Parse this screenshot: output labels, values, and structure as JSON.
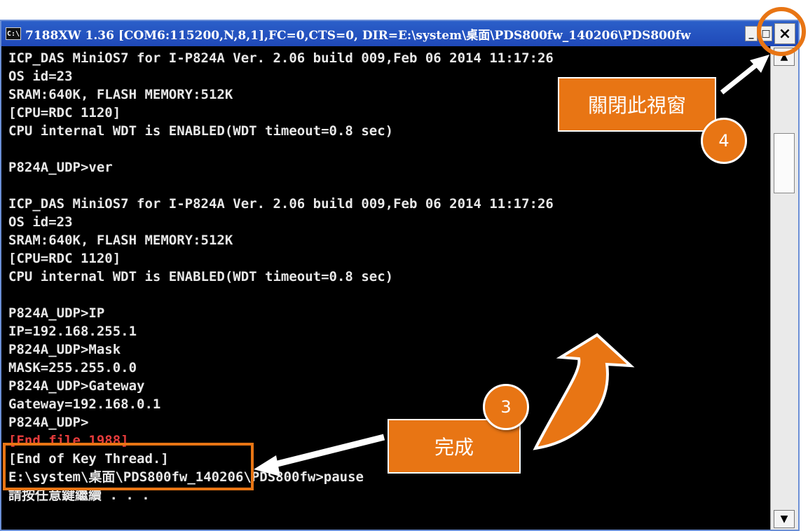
{
  "window": {
    "icon_text": "C:\\",
    "title": "7188XW 1.36 [COM6:115200,N,8,1],FC=0,CTS=0, DIR=E:\\system\\桌面\\PDS800fw_140206\\PDS800fw",
    "minimize_glyph": "_",
    "maximize_glyph": "□",
    "close_glyph": "×"
  },
  "console": {
    "lines": [
      "ICP_DAS MiniOS7 for I-P824A Ver. 2.06 build 009,Feb 06 2014 11:17:26",
      "OS id=23",
      "SRAM:640K, FLASH MEMORY:512K",
      "[CPU=RDC 1120]",
      "CPU internal WDT is ENABLED(WDT timeout=0.8 sec)",
      "",
      "P824A_UDP>ver",
      "",
      "ICP_DAS MiniOS7 for I-P824A Ver. 2.06 build 009,Feb 06 2014 11:17:26",
      "OS id=23",
      "SRAM:640K, FLASH MEMORY:512K",
      "[CPU=RDC 1120]",
      "CPU internal WDT is ENABLED(WDT timeout=0.8 sec)",
      "",
      "P824A_UDP>IP",
      "IP=192.168.255.1",
      "P824A_UDP>Mask",
      "MASK=255.255.0.0",
      "P824A_UDP>Gateway",
      "Gateway=192.168.0.1",
      "P824A_UDP>",
      "[End file 1988]",
      "[End of Key Thread.]",
      "E:\\system\\桌面\\PDS800fw_140206\\PDS800fw>pause",
      "請按任意鍵繼續 . . ."
    ]
  },
  "scrollbar": {
    "up_glyph": "▲",
    "down_glyph": "▼"
  },
  "annotations": {
    "close_label": "關閉此視窗",
    "close_step": "4",
    "done_label": "完成",
    "done_step": "3"
  },
  "colors": {
    "accent": "#e87514",
    "title_bar": "#1f49b8",
    "console_bg": "#000000",
    "highlight_text": "#e53b3b"
  }
}
